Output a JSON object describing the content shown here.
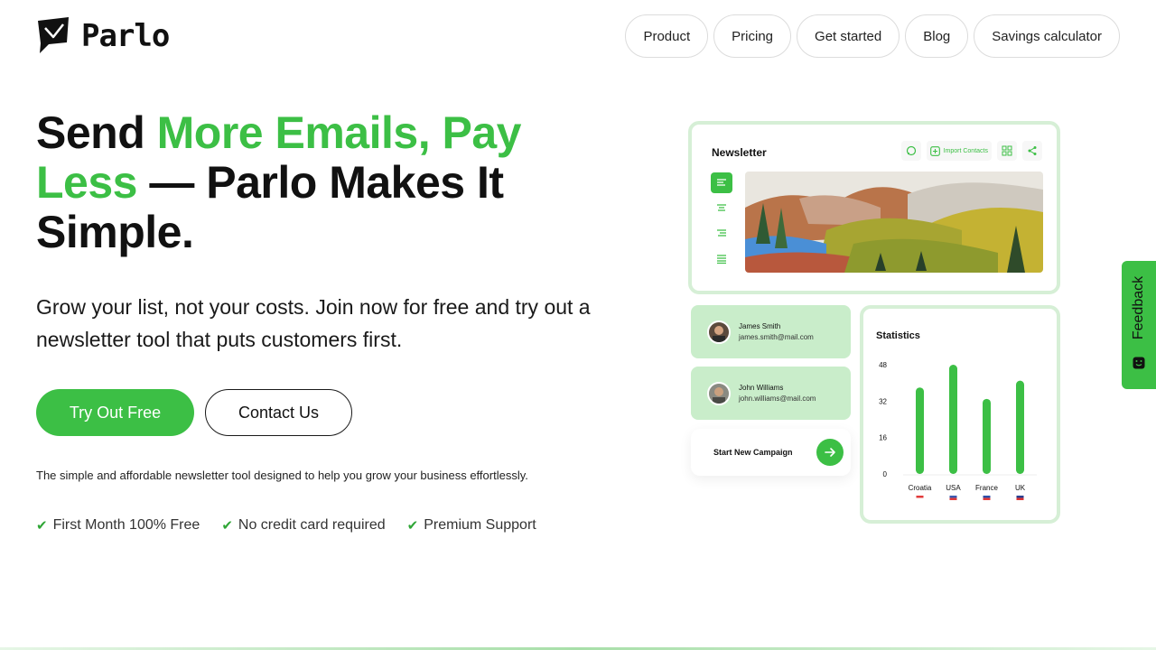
{
  "brand": {
    "name": "Parlo"
  },
  "nav": {
    "items": [
      {
        "label": "Product"
      },
      {
        "label": "Pricing"
      },
      {
        "label": "Get started"
      },
      {
        "label": "Blog"
      },
      {
        "label": "Savings calculator"
      }
    ]
  },
  "hero": {
    "title_part1": "Send ",
    "title_accent": "More Emails, Pay Less",
    "title_part2": " — Parlo Makes It Simple.",
    "subtitle": "Grow your list, not your costs. Join now for free and try out a newsletter tool that puts customers first.",
    "primary_cta": "Try Out Free",
    "secondary_cta": "Contact Us",
    "tagline": "The simple and affordable newsletter tool designed to help you grow your business effortlessly.",
    "features": [
      "First Month 100% Free",
      "No credit card required",
      "Premium Support"
    ]
  },
  "mockup": {
    "newsletter_title": "Newsletter",
    "import_label": "Import Contacts",
    "contacts": [
      {
        "name": "James Smith",
        "email": "james.smith@mail.com"
      },
      {
        "name": "John Williams",
        "email": "john.williams@mail.com"
      }
    ],
    "campaign_label": "Start New Campaign",
    "stats_title": "Statistics"
  },
  "chart_data": {
    "type": "bar",
    "title": "Statistics",
    "categories": [
      "Croatia",
      "USA",
      "France",
      "UK"
    ],
    "values": [
      38,
      48,
      33,
      41
    ],
    "yticks": [
      0,
      16,
      32,
      48
    ],
    "ylim": [
      0,
      48
    ],
    "color": "#3cbf45"
  },
  "feedback": {
    "label": "Feedback"
  },
  "colors": {
    "accent": "#3cbf45",
    "card_border": "#d6efd6",
    "contact_bg": "#c9edca"
  }
}
